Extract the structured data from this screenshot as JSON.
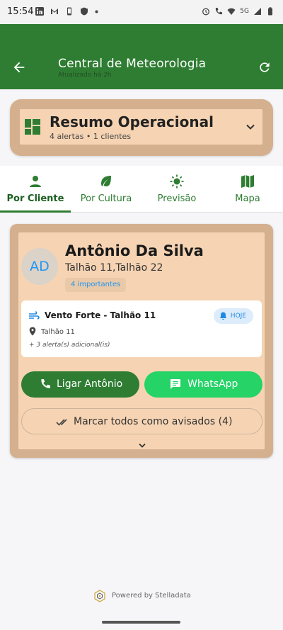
{
  "status_bar": {
    "time": "15:54",
    "network_label": "5G",
    "icons": [
      "linkedin-icon",
      "gmail-icon",
      "phone-icon",
      "shield-icon",
      "dot-icon",
      "alarm-icon",
      "call-icon",
      "wifi-icon",
      "signal-icon",
      "battery-icon"
    ]
  },
  "app_bar": {
    "title": "Central de Meteorologia",
    "subtitle": "Atualizado há 2h",
    "back_icon": "arrow-back-icon",
    "refresh_icon": "refresh-icon",
    "color": "#2e7d32"
  },
  "summary": {
    "title": "Resumo Operacional",
    "subtitle": "4 alertas • 1 clientes",
    "icon": "dashboard-icon"
  },
  "tabs": [
    {
      "label": "Por Cliente",
      "icon": "person-icon",
      "active": true
    },
    {
      "label": "Por Cultura",
      "icon": "leaf-icon",
      "active": false
    },
    {
      "label": "Previsão",
      "icon": "sun-icon",
      "active": false
    },
    {
      "label": "Mapa",
      "icon": "map-icon",
      "active": false
    }
  ],
  "client": {
    "initials": "AD",
    "name": "Antônio Da Silva",
    "plots": "Talhão 11,Talhão 22",
    "badge": "4 importantes",
    "alert": {
      "title": "Vento Forte - Talhão 11",
      "tag": "HOJE",
      "location": "Talhão 11",
      "more": "+ 3 alerta(s) adicional(is)"
    },
    "call_label": "Ligar Antônio",
    "whatsapp_label": "WhatsApp",
    "mark_all_label": "Marcar todos como avisados (4)"
  },
  "footer": {
    "powered": "Powered by Stelladata"
  },
  "colors": {
    "primary": "#2e7d32",
    "whatsapp": "#25d366",
    "card_border": "#d4b08f",
    "card_fill": "#f6d4b3",
    "accent_blue": "#2196f3"
  }
}
